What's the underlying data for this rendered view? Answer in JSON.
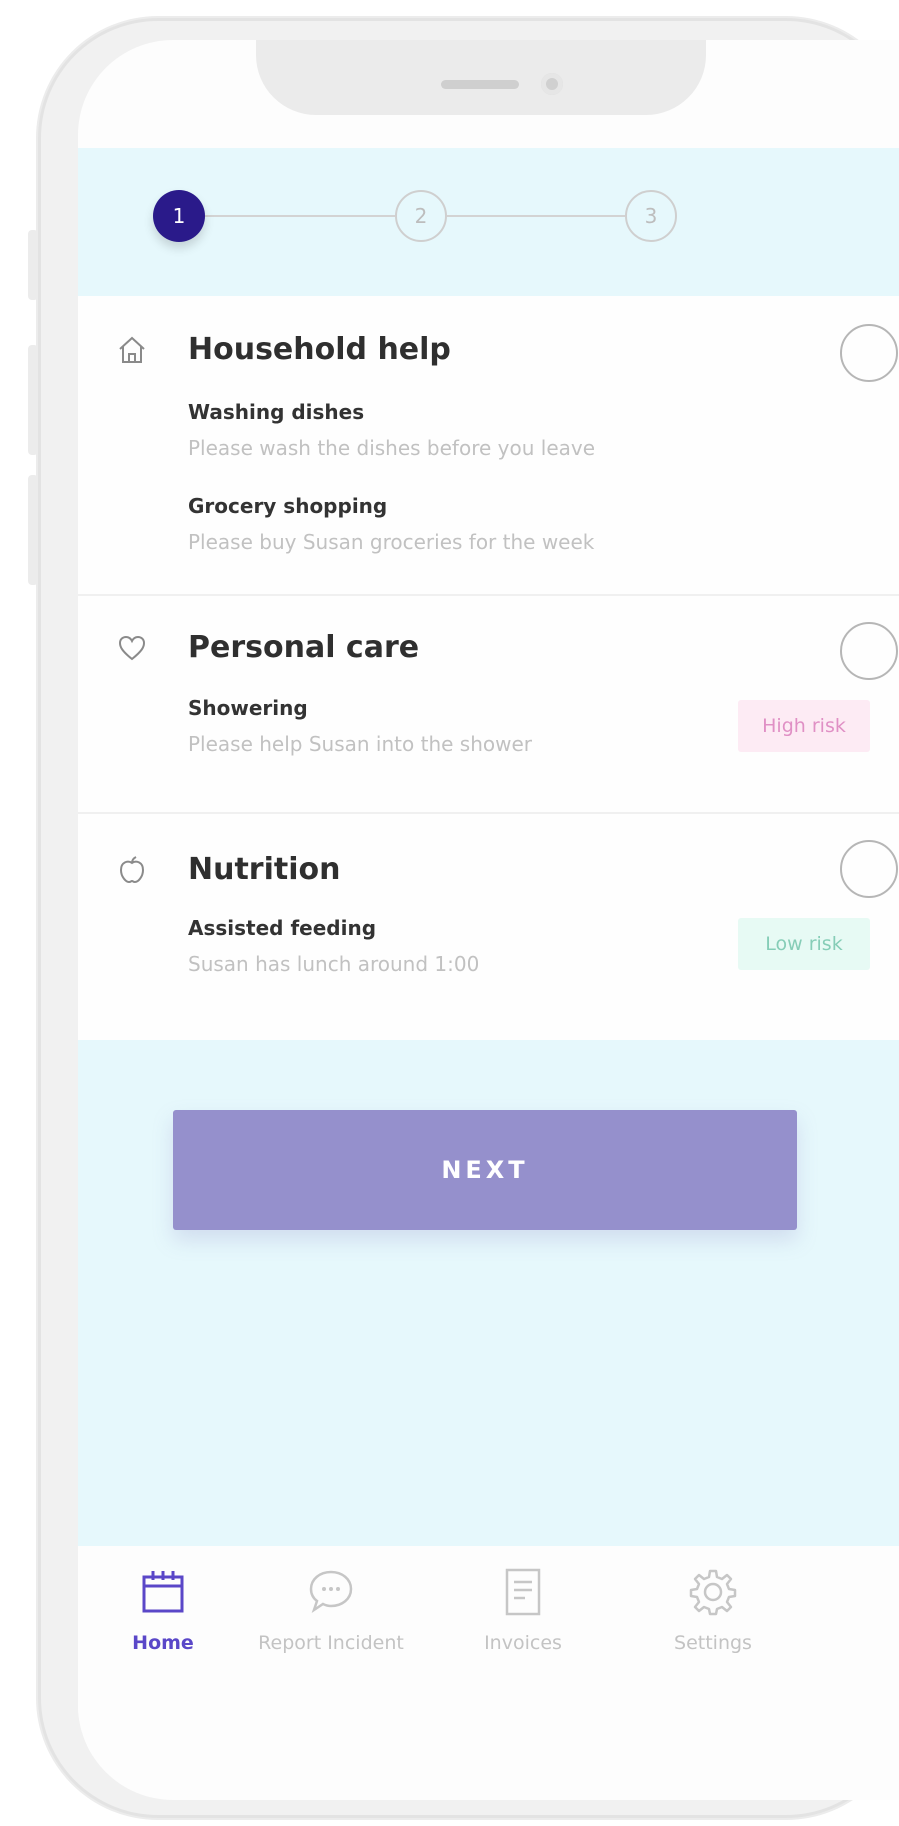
{
  "stepper": {
    "steps": [
      "1",
      "2",
      "3"
    ],
    "active_step": 1
  },
  "categories": [
    {
      "title": "Household help",
      "icon": "home-icon",
      "tasks": [
        {
          "title": "Washing dishes",
          "description": "Please wash the dishes before you leave"
        },
        {
          "title": "Grocery shopping",
          "description": "Please buy Susan groceries for the week"
        }
      ]
    },
    {
      "title": "Personal care",
      "icon": "heart-icon",
      "tasks": [
        {
          "title": "Showering",
          "description": "Please help Susan into the shower",
          "badge": "High risk"
        }
      ]
    },
    {
      "title": "Nutrition",
      "icon": "apple-icon",
      "tasks": [
        {
          "title": "Assisted feeding",
          "description": "Susan has lunch around 1:00",
          "badge": "Low risk"
        }
      ]
    }
  ],
  "next_button": {
    "label": "NEXT"
  },
  "tabbar": {
    "items": [
      {
        "label": "Home",
        "icon": "calendar-icon",
        "active": true
      },
      {
        "label": "Report Incident",
        "icon": "chat-bubble-icon",
        "active": false
      },
      {
        "label": "Invoices",
        "icon": "document-icon",
        "active": false
      },
      {
        "label": "Settings",
        "icon": "gear-icon",
        "active": false
      }
    ]
  },
  "colors": {
    "accent": "#2a1a8a",
    "button": "#9590cc",
    "panel_bg": "#e6f8fc",
    "high_risk": "#e090c5",
    "low_risk": "#86cdb7",
    "active_tab": "#5a47c8"
  }
}
